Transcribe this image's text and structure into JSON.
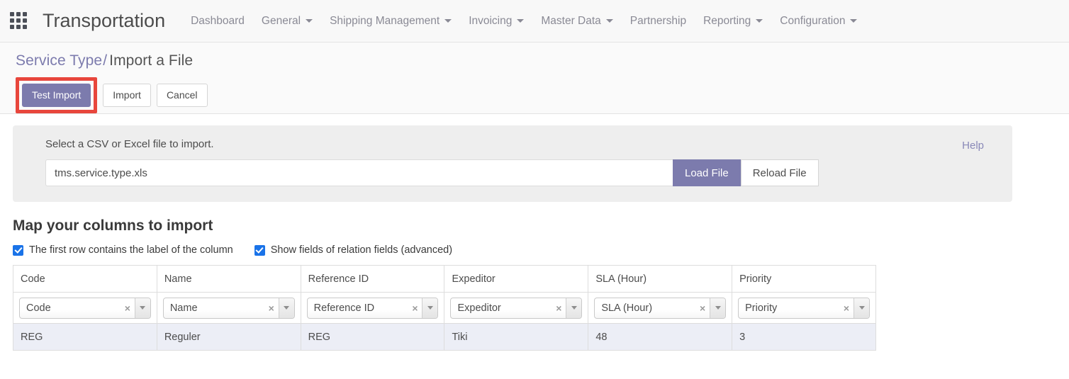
{
  "navbar": {
    "apps_icon": "apps-grid-icon",
    "brand": "Transportation",
    "items": [
      {
        "label": "Dashboard",
        "has_caret": false
      },
      {
        "label": "General",
        "has_caret": true
      },
      {
        "label": "Shipping Management",
        "has_caret": true
      },
      {
        "label": "Invoicing",
        "has_caret": true
      },
      {
        "label": "Master Data",
        "has_caret": true
      },
      {
        "label": "Partnership",
        "has_caret": false
      },
      {
        "label": "Reporting",
        "has_caret": true
      },
      {
        "label": "Configuration",
        "has_caret": true
      }
    ]
  },
  "breadcrumb": {
    "parent": "Service Type",
    "separator": "/",
    "current": "Import a File"
  },
  "actions": {
    "test_import": "Test Import",
    "import": "Import",
    "cancel": "Cancel",
    "highlighted": "Test Import"
  },
  "file_panel": {
    "instruction": "Select a CSV or Excel file to import.",
    "help_label": "Help",
    "file_value": "tms.service.type.xls",
    "file_placeholder": "",
    "load_file_label": "Load File",
    "reload_file_label": "Reload File"
  },
  "map_section": {
    "title": "Map your columns to import",
    "options": [
      {
        "label": "The first row contains the label of the column",
        "checked": true
      },
      {
        "label": "Show fields of relation fields (advanced)",
        "checked": true
      }
    ],
    "headers": [
      "Code",
      "Name",
      "Reference ID",
      "Expeditor",
      "SLA (Hour)",
      "Priority"
    ],
    "mappings": [
      "Code",
      "Name",
      "Reference ID",
      "Expeditor",
      "SLA (Hour)",
      "Priority"
    ],
    "clear_icon": "×",
    "rows": [
      [
        "REG",
        "Reguler",
        "REG",
        "Tiki",
        "48",
        "3"
      ]
    ]
  },
  "colors": {
    "accent_purple": "#7c7bad",
    "highlight_red": "#e8463c",
    "checkbox_blue": "#1a73e8",
    "row_background": "#eceef6",
    "panel_gray": "#eeeeee"
  }
}
